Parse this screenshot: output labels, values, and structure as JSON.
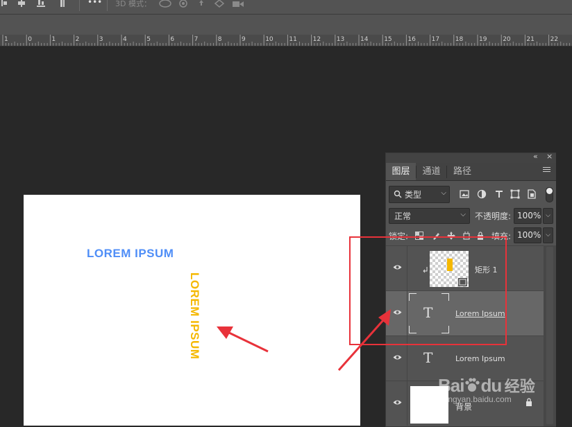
{
  "options_bar": {
    "more_label": "•••",
    "mode_label": "3D 模式："
  },
  "ruler": {
    "ticks": [
      "1",
      "0",
      "1",
      "2",
      "3",
      "4",
      "5",
      "6",
      "7",
      "8",
      "9",
      "10",
      "11",
      "12",
      "13",
      "14",
      "15",
      "16",
      "17",
      "18",
      "19",
      "20",
      "21",
      "22"
    ]
  },
  "document": {
    "horizontal_text": "LOREM IPSUM",
    "vertical_text": "LOREM IPSUM",
    "horizontal_color": "#4f8ef7",
    "vertical_color": "#f5b800"
  },
  "layers_panel": {
    "collapse_icon": "double-chevron-icon",
    "close_label": "×",
    "tabs": [
      {
        "label": "图层",
        "active": true
      },
      {
        "label": "通道",
        "active": false
      },
      {
        "label": "路径",
        "active": false
      }
    ],
    "filter": {
      "label": "类型",
      "icon": "search-icon"
    },
    "filter_icons": [
      "image-filter-icon",
      "adjustment-filter-icon",
      "type-filter-icon",
      "shape-filter-icon",
      "smart-object-filter-icon"
    ],
    "blend_mode": "正常",
    "opacity_label": "不透明度:",
    "opacity_value": "100%",
    "lock_label": "锁定:",
    "fill_label": "填充:",
    "fill_value": "100%",
    "layers": [
      {
        "name": "矩形 1",
        "type": "shape",
        "visible": true,
        "selected": false,
        "clipped": true
      },
      {
        "name": "Lorem Ipsum",
        "type": "text",
        "visible": true,
        "selected": true
      },
      {
        "name": "Lorem Ipsum",
        "type": "text",
        "visible": true,
        "selected": false
      },
      {
        "name": "背景",
        "type": "background",
        "visible": true,
        "selected": false
      }
    ]
  },
  "watermark": {
    "brand": "Bai",
    "brand_tail": "du",
    "suffix": "经验",
    "url": "jingyan.baidu.com"
  },
  "annotation_color": "#e8323a"
}
